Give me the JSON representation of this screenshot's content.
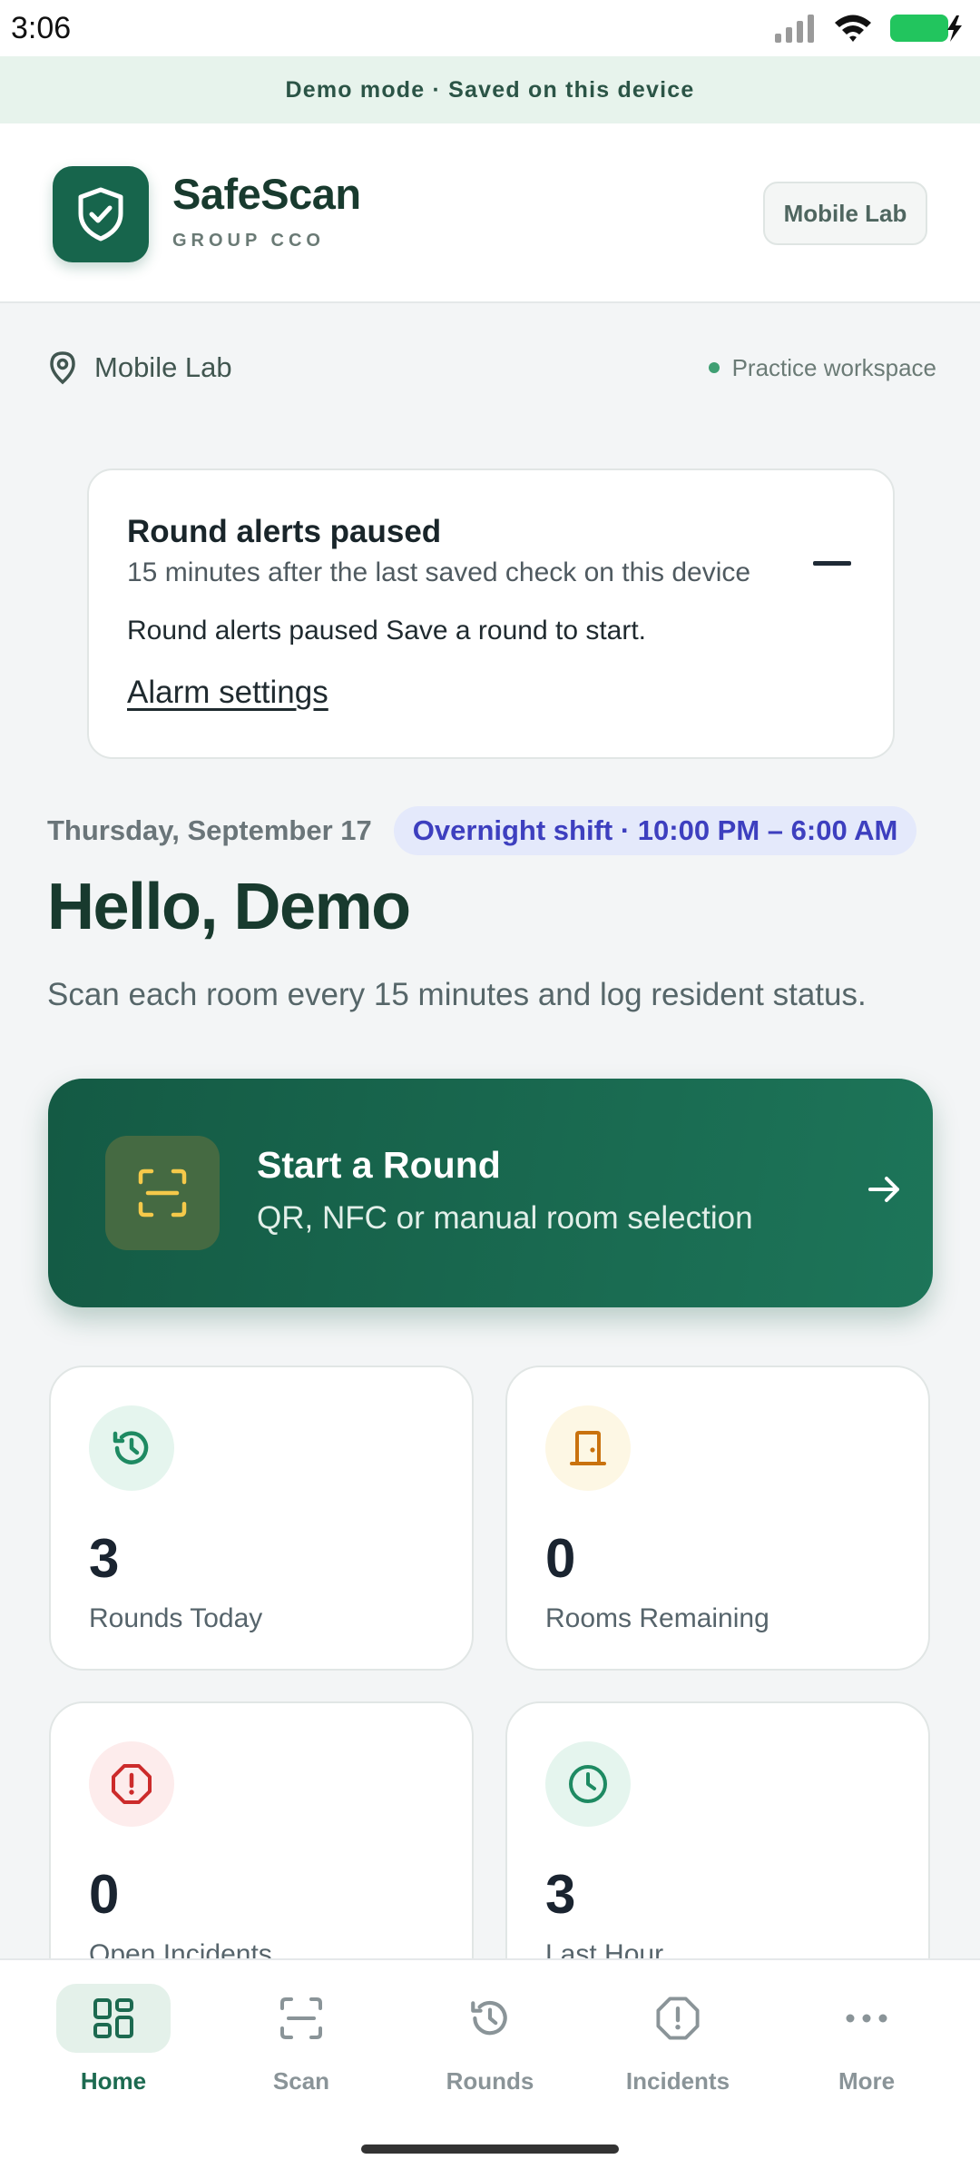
{
  "status_bar": {
    "time": "3:06",
    "icons": [
      "signal-icon",
      "wifi-icon",
      "battery-charging-icon"
    ]
  },
  "banner": {
    "text": "Demo mode · Saved on this device"
  },
  "header": {
    "brand": "SafeScan",
    "subtitle": "GROUP CCO",
    "location_pill": "Mobile Lab",
    "logo_icon": "shield-check-icon"
  },
  "location": {
    "name": "Mobile Lab",
    "workspace": "Practice workspace",
    "workspace_dot_color": "#3f9f73"
  },
  "alert": {
    "title": "Round alerts paused",
    "subtitle": "15 minutes after the last saved check on this device",
    "body": "Round alerts paused Save a round to start.",
    "link": "Alarm settings"
  },
  "shift": {
    "date": "Thursday, September 17",
    "shift_label": "Overnight shift · 10:00 PM – 6:00 AM"
  },
  "greeting": "Hello, Demo",
  "instruction": "Scan each room every 15 minutes and log resident status.",
  "start_round": {
    "title": "Start a Round",
    "subtitle": "QR, NFC or manual room selection",
    "icon": "scan-frame-icon"
  },
  "stats": [
    {
      "value": "3",
      "label": "Rounds Today",
      "icon": "history-icon",
      "icon_bg": "#e5f5ee",
      "icon_color": "#1e8a62"
    },
    {
      "value": "0",
      "label": "Rooms Remaining",
      "icon": "door-icon",
      "icon_bg": "#fdf7e4",
      "icon_color": "#c9720e"
    },
    {
      "value": "0",
      "label": "Open Incidents",
      "icon": "alert-octagon-icon",
      "icon_bg": "#fdecec",
      "icon_color": "#cc2b2b"
    },
    {
      "value": "3",
      "label": "Last Hour",
      "icon": "clock-icon",
      "icon_bg": "#e5f5ee",
      "icon_color": "#1e8a62"
    }
  ],
  "nav": [
    {
      "label": "Home",
      "icon": "grid-icon",
      "active": true
    },
    {
      "label": "Scan",
      "icon": "scan-icon",
      "active": false
    },
    {
      "label": "Rounds",
      "icon": "history-icon",
      "active": false
    },
    {
      "label": "Incidents",
      "icon": "alert-octagon-icon",
      "active": false
    },
    {
      "label": "More",
      "icon": "more-dots-icon",
      "active": false
    }
  ],
  "colors": {
    "brand_green": "#17654c",
    "accent_indigo": "#3d3fbf",
    "background": "#f3f5f6"
  }
}
